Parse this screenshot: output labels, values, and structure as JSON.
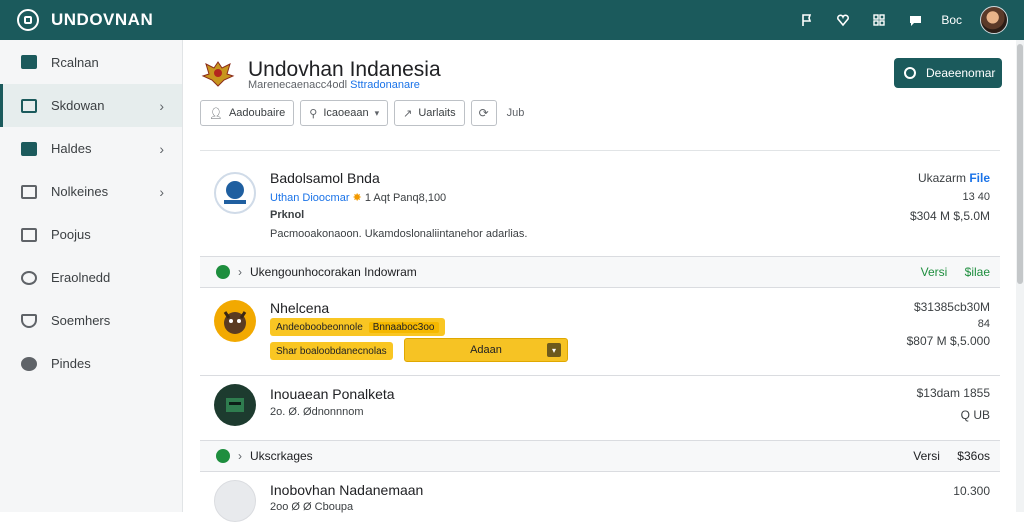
{
  "app": {
    "name": "UNDOVNAN"
  },
  "topbar": {
    "user_label": "Boc",
    "icons": [
      "flag-icon",
      "heart-icon",
      "grid-icon",
      "chat-icon"
    ]
  },
  "sidebar": {
    "items": [
      {
        "label": "Rcalnan",
        "icon": "folder-icon"
      },
      {
        "label": "Skdowan",
        "icon": "table-icon"
      },
      {
        "label": "Haldes",
        "icon": "users-icon"
      },
      {
        "label": "Nolkeines",
        "icon": "document-icon"
      },
      {
        "label": "Poojus",
        "icon": "clipboard-icon"
      },
      {
        "label": "Eraolnedd",
        "icon": "location-icon"
      },
      {
        "label": "Soemhers",
        "icon": "shield-icon"
      },
      {
        "label": "Pindes",
        "icon": "gear-icon"
      }
    ]
  },
  "header": {
    "title": "Undovhan Indanesia",
    "subtitle_prefix": "Marenecaenacc4odl",
    "subtitle_link": "Sttradonanare",
    "primary_button": "Deaeenomar"
  },
  "toolbar": {
    "filter_label": "Aadoubaire",
    "sort_label": "Icaoeaan",
    "trend_label": "Uarlaits",
    "extra_label": "Jub"
  },
  "records": [
    {
      "name": "Badolsamol Bnda",
      "meta1_link": "Uthan Dioocmar",
      "meta1_rest": "1  Aqt  Panq8,100",
      "meta2": "Prknol",
      "meta3": "Pacmooakonaoon.  Ukamdoslonaliintanehor adarlias.",
      "right_title": "Ukazarm",
      "right_title_link": "File",
      "right_line2": "13 40",
      "right_line3": "$304 M $,5.0M"
    },
    {
      "name": "Nhelcena",
      "tag1": "Andeoboobeonnole",
      "tag1_inner": "Bnnaaboc3oo",
      "tag2": "Shar boaloobdanecnolas",
      "action_button": "Adaan",
      "right_line1": "$31385cb30M",
      "right_line2": "84",
      "right_line3": "$807 M $,5.000"
    },
    {
      "name": "Inouaean Ponalketa",
      "meta1": "2o. Ø. Ødnonnnom",
      "right_line1": "$13dam 1855",
      "right_line2": "Q  UB"
    },
    {
      "name": "Inobovhan Nadanemaan",
      "meta1": "2oo Ø Ø Cboupa",
      "right_line1": "10.300"
    }
  ],
  "groups": [
    {
      "title": "Ukengounhocorakan Indowram",
      "right_a": "Versi",
      "right_b": "$ilae"
    },
    {
      "title": "Ukscrkages",
      "right_a": "Versi",
      "right_b": "$36os"
    }
  ],
  "colors": {
    "brand": "#1b5a5c",
    "link": "#1a73e8",
    "success": "#1e8e3e",
    "highlight": "#f9c623"
  }
}
